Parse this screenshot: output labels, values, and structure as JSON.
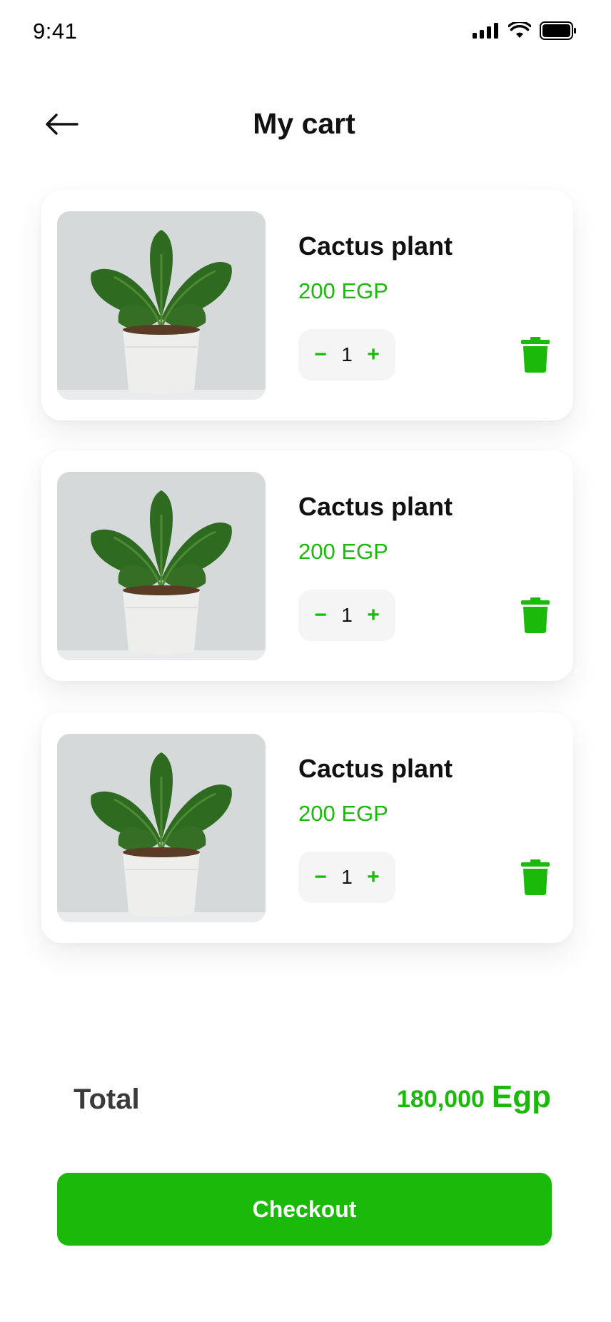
{
  "status_bar": {
    "time": "9:41",
    "icons": [
      "signal-icon",
      "wifi-icon",
      "battery-icon"
    ]
  },
  "header": {
    "back_icon": "arrow-left-icon",
    "title": "My cart"
  },
  "cart": {
    "items": [
      {
        "name": "Cactus plant",
        "price": "200 EGP",
        "quantity": "1",
        "decrement": "−",
        "increment": "+",
        "image": "potted-plant-image",
        "delete_icon": "trash-icon"
      },
      {
        "name": "Cactus plant",
        "price": "200 EGP",
        "quantity": "1",
        "decrement": "−",
        "increment": "+",
        "image": "potted-plant-image",
        "delete_icon": "trash-icon"
      },
      {
        "name": "Cactus plant",
        "price": "200 EGP",
        "quantity": "1",
        "decrement": "−",
        "increment": "+",
        "image": "potted-plant-image",
        "delete_icon": "trash-icon"
      }
    ]
  },
  "summary": {
    "total_label": "Total",
    "total_amount": "180,000",
    "total_currency": "Egp"
  },
  "checkout": {
    "label": "Checkout"
  },
  "colors": {
    "accent": "#1ab90a",
    "text": "#111111",
    "stepper_bg": "#f5f5f5"
  }
}
